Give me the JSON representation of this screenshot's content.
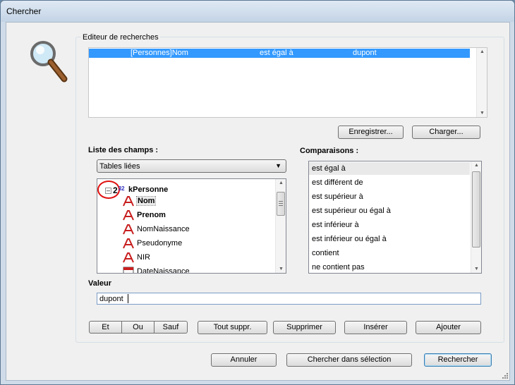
{
  "window": {
    "title": "Chercher"
  },
  "editor": {
    "title": "Editeur de recherches",
    "criteria": [
      {
        "field": "[Personnes]Nom",
        "operator": "est égal à",
        "value": "dupont"
      }
    ],
    "save_label": "Enregistrer...",
    "load_label": "Charger..."
  },
  "fields": {
    "title": "Liste des champs :",
    "dropdown_value": "Tables liées",
    "root": {
      "key_digit": "2",
      "key_superscript": "32",
      "label": "kPersonne"
    },
    "items": [
      {
        "label": "Nom",
        "type": "text",
        "bold": true
      },
      {
        "label": "Prenom",
        "type": "text",
        "bold": true
      },
      {
        "label": "NomNaissance",
        "type": "text",
        "bold": false
      },
      {
        "label": "Pseudonyme",
        "type": "text",
        "bold": false
      },
      {
        "label": "NIR",
        "type": "text",
        "bold": false
      },
      {
        "label": "DateNaissance",
        "type": "date",
        "bold": false
      }
    ]
  },
  "comparisons": {
    "title": "Comparaisons :",
    "items": [
      "est égal à",
      "est différent de",
      "est supérieur à",
      "est supérieur ou égal à",
      "est inférieur à",
      "est inférieur ou égal à",
      "contient",
      "ne contient pas"
    ],
    "selected_index": 0
  },
  "value": {
    "label": "Valeur",
    "current": "dupont"
  },
  "logic": {
    "and": "Et",
    "or": "Ou",
    "except": "Sauf"
  },
  "actions": {
    "clear_all": "Tout suppr.",
    "delete": "Supprimer",
    "insert": "Insérer",
    "add": "Ajouter"
  },
  "footer": {
    "cancel": "Annuler",
    "search_in_selection": "Chercher dans sélection",
    "search": "Rechercher"
  },
  "icons": {
    "magnifier": "magnifier-icon",
    "text_field": "text-field-icon",
    "date_field": "calendar-icon"
  },
  "colors": {
    "selection": "#3399ff",
    "highlight_circle": "#e01010"
  }
}
